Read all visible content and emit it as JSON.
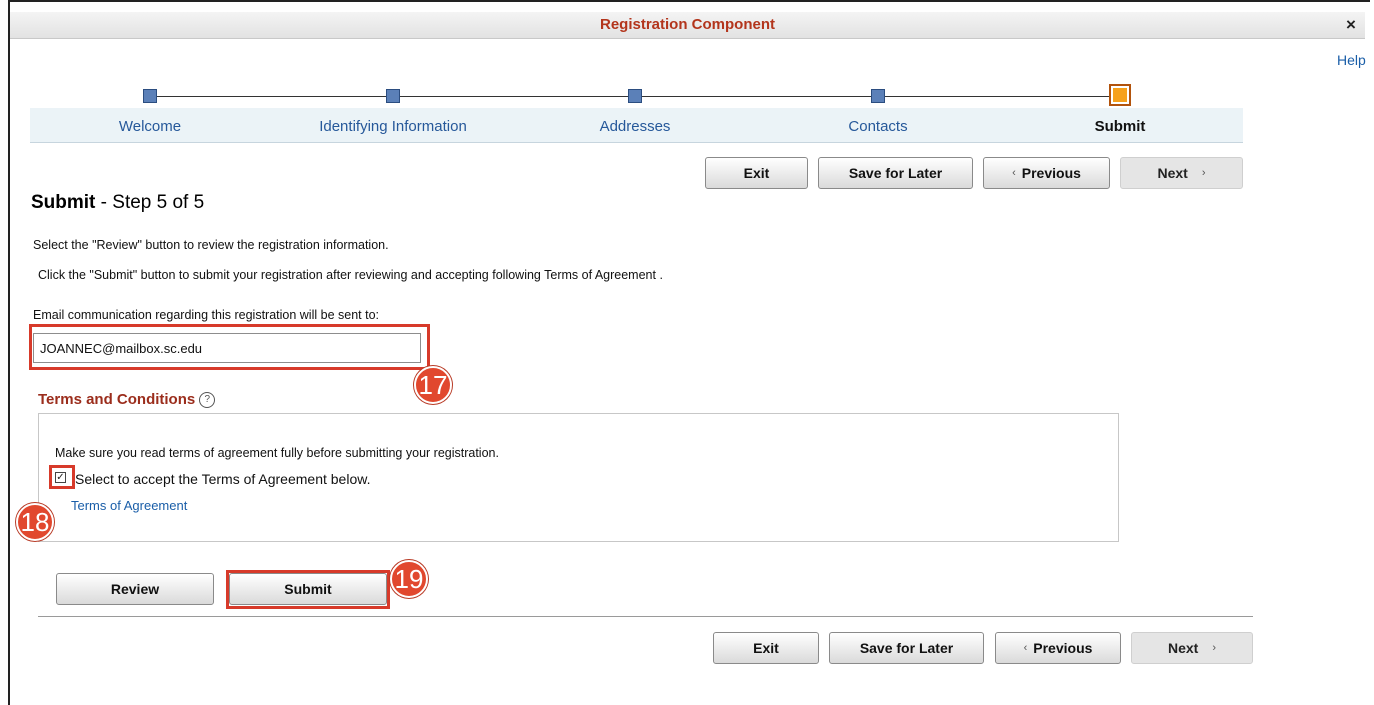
{
  "window": {
    "title": "Registration Component",
    "close_symbol": "×",
    "help_label": "Help"
  },
  "stepper": {
    "steps": [
      {
        "label": "Welcome"
      },
      {
        "label": "Identifying Information"
      },
      {
        "label": "Addresses"
      },
      {
        "label": "Contacts"
      },
      {
        "label": "Submit"
      }
    ],
    "current_index": 4
  },
  "nav": {
    "exit": "Exit",
    "save": "Save for Later",
    "previous": "Previous",
    "next": "Next",
    "prev_chevron": "‹",
    "next_chevron": "›"
  },
  "heading": {
    "title": "Submit",
    "subtitle": " - Step 5 of 5"
  },
  "instructions": {
    "line1": "Select the \"Review\" button to review the registration information.",
    "line2": "Click the \"Submit\" button to submit your registration after reviewing and accepting following Terms of Agreement ."
  },
  "email": {
    "label": "Email communication regarding this registration will be sent to:",
    "value": "JOANNEC@mailbox.sc.edu"
  },
  "terms": {
    "title": "Terms and Conditions",
    "help_glyph": "?",
    "notice": "Make sure you read terms of agreement fully before submitting your registration.",
    "checkbox_label": "Select to accept the Terms of Agreement below.",
    "checkbox_checked": true,
    "check_glyph": "✓",
    "link": "Terms of Agreement"
  },
  "actions": {
    "review": "Review",
    "submit": "Submit"
  },
  "callouts": {
    "email": "17",
    "checkbox": "18",
    "submit": "19"
  },
  "colors": {
    "title": "#b3351c",
    "accent_red": "#d73a2a",
    "link": "#1a5ea8",
    "step": "#5b80b8",
    "step_current": "#f6a11c"
  }
}
